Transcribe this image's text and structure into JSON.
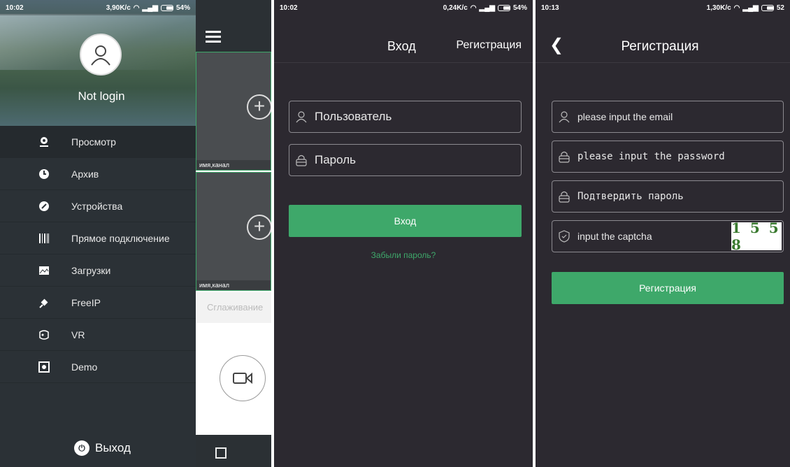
{
  "screen1": {
    "status": {
      "time": "10:02",
      "speed": "3,90K/c",
      "battery": "54%"
    },
    "profile": {
      "login_status": "Not login"
    },
    "menu": [
      {
        "label": "Просмотр",
        "icon": "camera-icon"
      },
      {
        "label": "Архив",
        "icon": "clock-icon"
      },
      {
        "label": "Устройства",
        "icon": "wrench-icon"
      },
      {
        "label": "Прямое подключение",
        "icon": "barcode-icon"
      },
      {
        "label": "Загрузки",
        "icon": "image-icon"
      },
      {
        "label": "FreeIP",
        "icon": "plug-icon"
      },
      {
        "label": "VR",
        "icon": "vr-headset-icon"
      },
      {
        "label": "Demo",
        "icon": "play-box-icon"
      }
    ],
    "logout_label": "Выход",
    "main": {
      "cells": [
        {
          "caption": "имя,канал"
        },
        {
          "caption": "имя,канал"
        }
      ],
      "smoothing_label": "Сглаживание"
    }
  },
  "screen2": {
    "status": {
      "time": "10:02",
      "speed": "0,24K/c",
      "battery": "54%"
    },
    "title": "Вход",
    "register_link": "Регистрация",
    "username_placeholder": "Пользователь",
    "password_placeholder": "Пароль",
    "login_button": "Вход",
    "forgot_link": "Забыли пароль?"
  },
  "screen3": {
    "status": {
      "time": "10:13",
      "speed": "1,30K/c",
      "battery": "52"
    },
    "title": "Регистрация",
    "email_placeholder": "please input the email",
    "password_placeholder": "please input the password",
    "confirm_placeholder": "Подтвердить пароль",
    "captcha_placeholder": "input the captcha",
    "captcha_code": "1 5 5 8",
    "register_button": "Регистрация"
  },
  "colors": {
    "accent": "#3ea86a",
    "panel_dark": "#2c2930",
    "drawer": "#2b3136"
  }
}
